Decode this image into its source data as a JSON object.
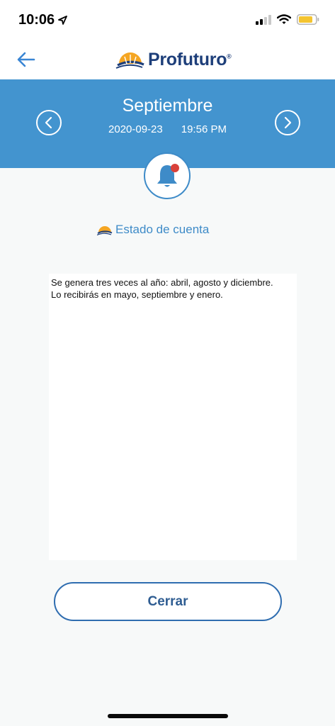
{
  "status_bar": {
    "time": "10:06",
    "icons": [
      "location-arrow-icon",
      "cellular-signal-icon",
      "wifi-icon",
      "battery-icon"
    ]
  },
  "header": {
    "back_icon": "back-arrow-icon",
    "logo_text": "Profuturo",
    "logo_mark": "®"
  },
  "month_band": {
    "title": "Septiembre",
    "date": "2020-09-23",
    "time": "19:56 PM",
    "prev_icon": "chevron-left-icon",
    "next_icon": "chevron-right-icon"
  },
  "notification": {
    "icon": "bell-icon",
    "subject": "Estado de cuenta"
  },
  "message": {
    "lines": [
      "Se genera tres veces al año: abril, agosto y diciembre.",
      "Lo recibirás en mayo, septiembre y enero."
    ]
  },
  "actions": {
    "close_label": "Cerrar"
  },
  "colors": {
    "brand_blue": "#4394cf",
    "logo_navy": "#1e3f7a",
    "accent_orange": "#f5a623",
    "alert_red": "#d9413a",
    "battery_yellow": "#f4c430"
  }
}
